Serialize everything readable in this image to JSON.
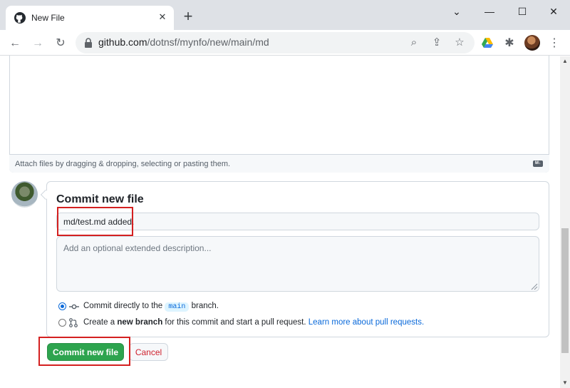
{
  "browser": {
    "tab_title": "New File",
    "url_host": "github.com",
    "url_path": "/dotnsf/mynfo/new/main/md"
  },
  "editor": {
    "attach_hint": "Attach files by dragging & dropping, selecting or pasting them.",
    "md_badge": "M↓"
  },
  "commit": {
    "title": "Commit new file",
    "summary_value": "md/test.md added.",
    "description_placeholder": "Add an optional extended description...",
    "option_direct": {
      "prefix": "Commit directly to the",
      "branch": "main",
      "suffix": "branch.",
      "selected": true
    },
    "option_new_branch": {
      "prefix": "Create a",
      "bold": "new branch",
      "middle": "for this commit and start a pull request.",
      "link": "Learn more about pull requests.",
      "selected": false
    },
    "submit_label": "Commit new file",
    "cancel_label": "Cancel"
  },
  "colors": {
    "primary_button": "#2da44e",
    "cancel_text": "#cf222e",
    "link": "#0969da",
    "highlight_box": "#d42020"
  }
}
